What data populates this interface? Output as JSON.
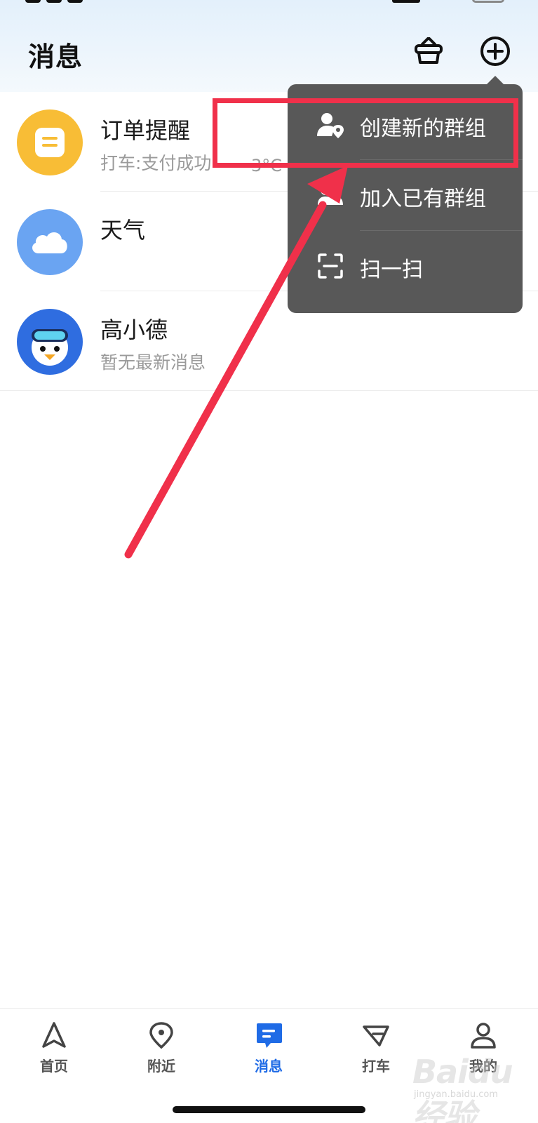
{
  "header": {
    "title": "消息",
    "basket_icon": "basket-icon",
    "add_icon": "plus-circle-icon"
  },
  "messages": [
    {
      "name": "订单提醒",
      "subtitle": "打车:支付成功",
      "avatar_icon": "order-note-icon",
      "avatar_color": "#f8bd36"
    },
    {
      "name": "天气",
      "subtitle": "",
      "temp_fragment": "3°C~",
      "avatar_icon": "cloud-icon",
      "avatar_color": "#6aa4f2"
    },
    {
      "name": "高小德",
      "subtitle": "暂无最新消息",
      "avatar_icon": "mascot-avatar",
      "avatar_color": "#2f6de0"
    }
  ],
  "popover_menu": {
    "items": [
      {
        "label": "创建新的群组",
        "icon": "person-location-icon"
      },
      {
        "label": "加入已有群组",
        "icon": "group-join-icon"
      },
      {
        "label": "扫一扫",
        "icon": "scan-icon"
      }
    ]
  },
  "annotation": {
    "highlight_color": "#f0304a",
    "arrow_color": "#f0304a"
  },
  "tabbar": {
    "active_index": 2,
    "active_color": "#1f6be6",
    "tabs": [
      {
        "label": "首页",
        "icon": "navigate-arrow-icon"
      },
      {
        "label": "附近",
        "icon": "location-pin-icon"
      },
      {
        "label": "消息",
        "icon": "message-icon"
      },
      {
        "label": "打车",
        "icon": "taxi-icon"
      },
      {
        "label": "我的",
        "icon": "profile-icon"
      }
    ]
  },
  "watermark": {
    "text": "Baidu经验",
    "sub": "jingyan.baidu.com"
  }
}
